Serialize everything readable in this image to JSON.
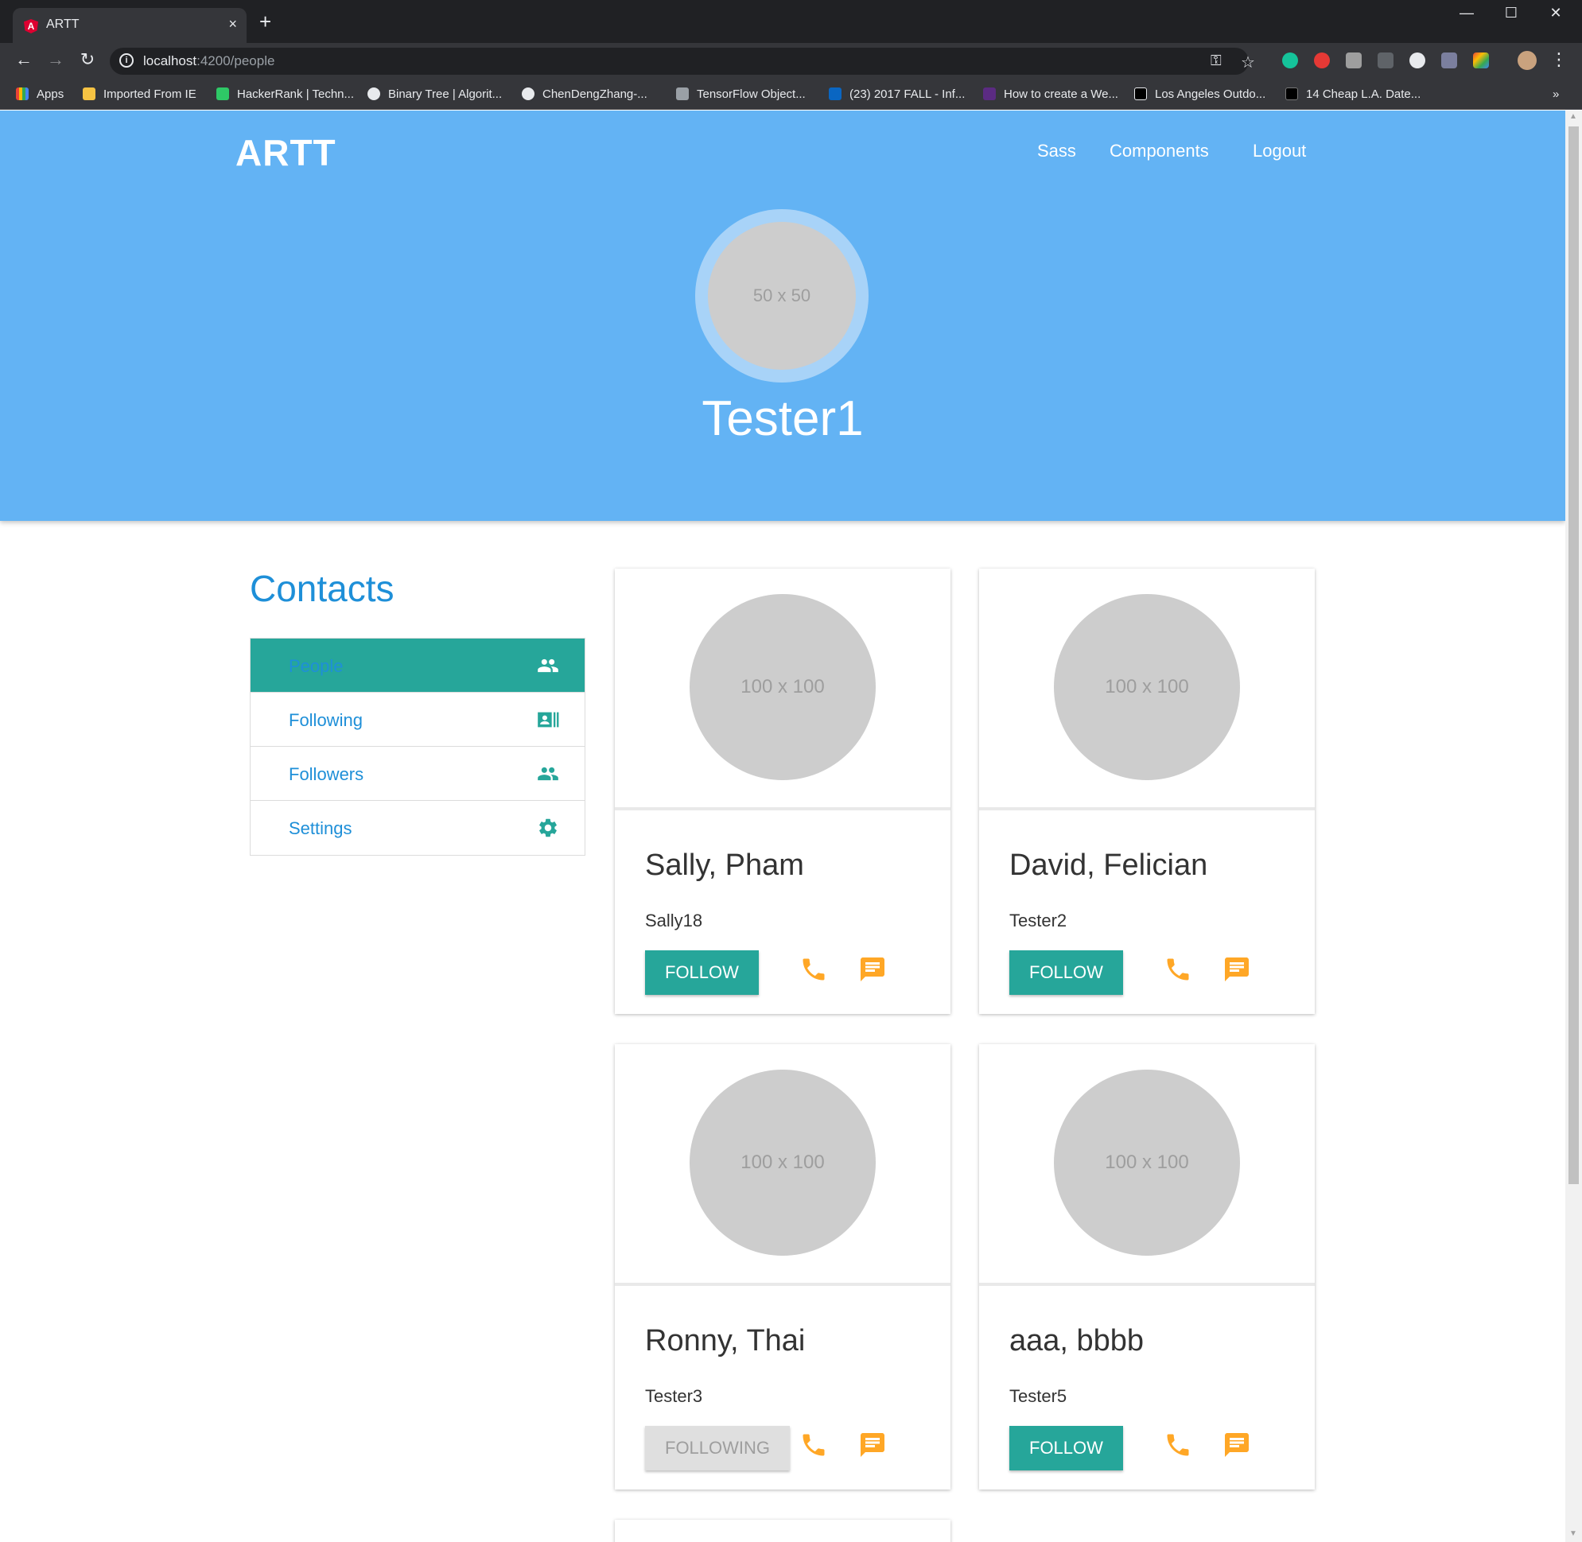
{
  "browser": {
    "tab_title": "ARTT",
    "tab_favicon": "A",
    "tab_close": "×",
    "new_tab": "+",
    "window_minimize": "—",
    "window_maximize": "☐",
    "window_close": "✕",
    "url_host": "localhost",
    "url_path": ":4200/people",
    "bookmarks": [
      {
        "label": "Apps",
        "color": "#e8453c"
      },
      {
        "label": "Imported From IE",
        "color": "#f6c343"
      },
      {
        "label": "HackerRank | Techn...",
        "color": "#2ec866"
      },
      {
        "label": "Binary Tree | Algorit...",
        "color": "#e8eaed"
      },
      {
        "label": "ChenDengZhang-...",
        "color": "#e8eaed"
      },
      {
        "label": "TensorFlow Object...",
        "color": "#9aa0a6"
      },
      {
        "label": "(23) 2017 FALL - Inf...",
        "color": "#0a66c2"
      },
      {
        "label": "How to create a We...",
        "color": "#5b2b82"
      },
      {
        "label": "Los Angeles Outdo...",
        "color": "#000000"
      },
      {
        "label": "14 Cheap L.A. Date...",
        "color": "#000000"
      }
    ],
    "bookmarks_more": "»"
  },
  "header": {
    "brand": "ARTT",
    "nav": [
      "Sass",
      "Components",
      "Logout"
    ],
    "avatar_text": "50 x 50",
    "username": "Tester1"
  },
  "sidebar": {
    "title": "Contacts",
    "items": [
      {
        "label": "People",
        "icon": "people-icon",
        "active": true
      },
      {
        "label": "Following",
        "icon": "contact-card-icon",
        "active": false
      },
      {
        "label": "Followers",
        "icon": "people-icon",
        "active": false
      },
      {
        "label": "Settings",
        "icon": "gear-icon",
        "active": false
      }
    ]
  },
  "contacts": [
    {
      "avatar_text": "100 x 100",
      "name": "Sally, Pham",
      "username": "Sally18",
      "button": "FOLLOW",
      "following": false
    },
    {
      "avatar_text": "100 x 100",
      "name": "David, Felician",
      "username": "Tester2",
      "button": "FOLLOW",
      "following": false
    },
    {
      "avatar_text": "100 x 100",
      "name": "Ronny, Thai",
      "username": "Tester3",
      "button": "FOLLOWING",
      "following": true
    },
    {
      "avatar_text": "100 x 100",
      "name": "aaa, bbbb",
      "username": "Tester5",
      "button": "FOLLOW",
      "following": false
    }
  ],
  "colors": {
    "hero": "#63b3f4",
    "accent_teal": "#26a69a",
    "link_blue": "#1e8fd8",
    "icon_orange": "#ffa726"
  }
}
